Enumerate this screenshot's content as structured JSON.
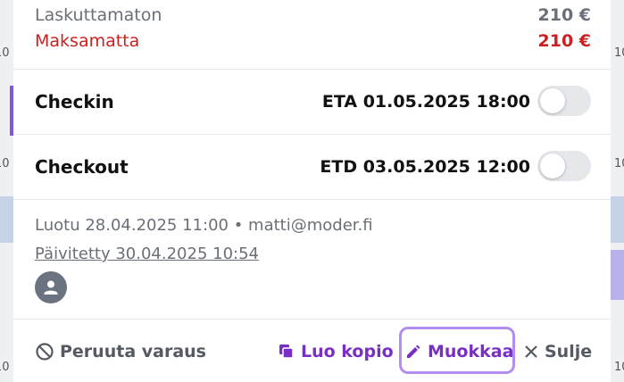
{
  "colors": {
    "accent": "#7a2fc4",
    "danger": "#cc1f1f",
    "muted": "#6b7078",
    "action_gray": "#555a62"
  },
  "pricing": {
    "unbilled_label": "Laskuttamaton",
    "unbilled_value": "210 €",
    "unpaid_label": "Maksamatta",
    "unpaid_value": "210 €"
  },
  "checkin": {
    "title": "Checkin",
    "time": "ETA 01.05.2025 18:00",
    "enabled": false
  },
  "checkout": {
    "title": "Checkout",
    "time": "ETD 03.05.2025 12:00",
    "enabled": false
  },
  "meta": {
    "created": "Luotu 28.04.2025 11:00 • matti@moder.fi",
    "updated": "Päivitetty 30.04.2025 10:54",
    "avatar_icon": "person-icon"
  },
  "actions": {
    "cancel_label": "Peruuta varaus",
    "copy_label": "Luo kopio",
    "edit_label": "Muokkaa",
    "close_label": "Sulje"
  },
  "background": {
    "edge_text": "10"
  }
}
